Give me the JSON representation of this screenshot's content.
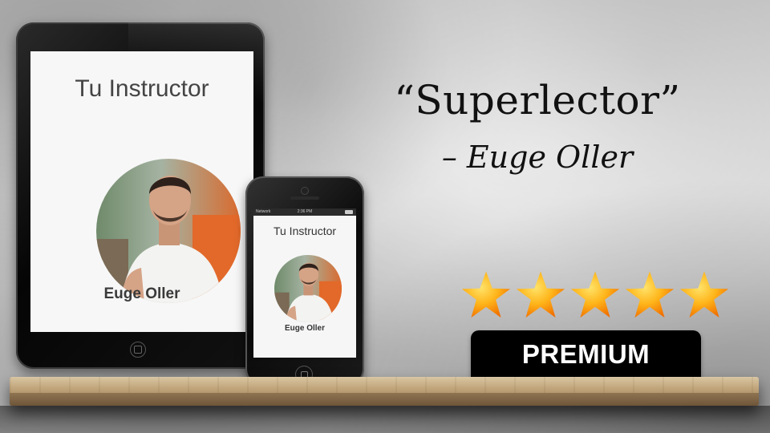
{
  "tablet": {
    "title": "Tu Instructor",
    "name": "Euge Oller"
  },
  "phone": {
    "carrier": "Network",
    "clock": "2:36 PM",
    "title": "Tu Instructor",
    "name": "Euge Oller"
  },
  "quote": {
    "text": "“Superlector”",
    "author": "– Euge Oller"
  },
  "rating": {
    "stars": 5,
    "max": 5,
    "icon": "star-icon",
    "color_light": "#ffd23a",
    "color_dark": "#f07a00"
  },
  "badge": {
    "label": "PREMIUM"
  }
}
